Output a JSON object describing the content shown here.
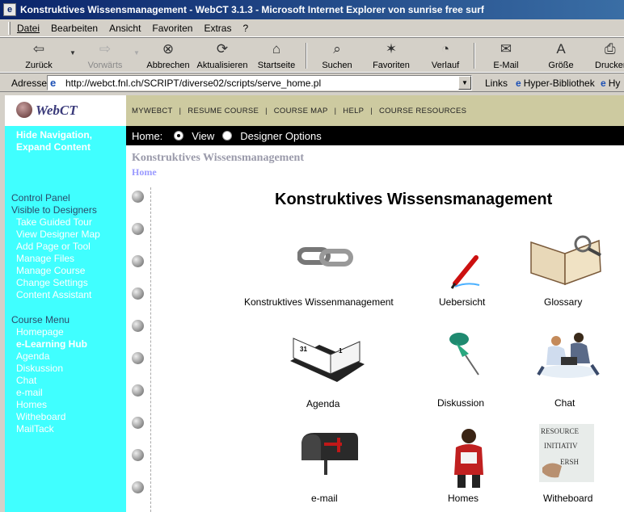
{
  "window": {
    "title": "Konstruktives Wissensmanagement - WebCT 3.1.3 - Microsoft Internet Explorer von sunrise free surf"
  },
  "menubar": [
    "Datei",
    "Bearbeiten",
    "Ansicht",
    "Favoriten",
    "Extras",
    "?"
  ],
  "toolbar": {
    "back": "Zurück",
    "forward": "Vorwärts",
    "stop": "Abbrechen",
    "refresh": "Aktualisieren",
    "home": "Startseite",
    "search": "Suchen",
    "favorites": "Favoriten",
    "history": "Verlauf",
    "mail": "E-Mail",
    "size": "Größe",
    "print": "Drucken"
  },
  "addressbar": {
    "label": "Adresse",
    "url": "http://webct.fnl.ch/SCRIPT/diverse02/scripts/serve_home.pl",
    "links_label": "Links",
    "links": [
      "Hyper-Bibliothek",
      "Hy"
    ]
  },
  "webct": {
    "logo": "WebCT",
    "topnav": [
      "MYWEBCT",
      "RESUME COURSE",
      "COURSE MAP",
      "HELP",
      "COURSE RESOURCES"
    ],
    "hide_nav": [
      "Hide Navigation,",
      "Expand Content"
    ],
    "homebar": {
      "label": "Home:",
      "options": [
        "View",
        "Designer Options"
      ],
      "selected": "View"
    },
    "breadcrumb": {
      "course": "Konstruktives Wissensmanagement",
      "page": "Home"
    },
    "control_panel": {
      "title": [
        "Control Panel",
        "Visible to Designers"
      ],
      "items": [
        "Take Guided Tour",
        "View Designer Map",
        "Add Page or Tool",
        "Manage Files",
        "Manage Course",
        "Change Settings",
        "Content Assistant"
      ]
    },
    "course_menu": {
      "title": "Course Menu",
      "items": [
        "Homepage",
        "e-Learning Hub",
        "Agenda",
        "Diskussion",
        "Chat",
        "e-mail",
        "Homes",
        "Witheboard",
        "MailTack"
      ],
      "current": "e-Learning Hub"
    },
    "main_title": "Konstruktives Wissensmanagement",
    "tiles": [
      {
        "label": "Konstruktives Wissenmanagement",
        "icon": "chain-link-icon"
      },
      {
        "label": "Uebersicht",
        "icon": "pen-icon"
      },
      {
        "label": "Glossary",
        "icon": "open-book-magnifier-icon"
      },
      {
        "label": "Agenda",
        "icon": "desk-calendar-icon"
      },
      {
        "label": "Diskussion",
        "icon": "pushpin-icon"
      },
      {
        "label": "Chat",
        "icon": "people-laptop-icon"
      },
      {
        "label": "e-mail",
        "icon": "mailbox-icon"
      },
      {
        "label": "Homes",
        "icon": "person-icon"
      },
      {
        "label": "Witheboard",
        "icon": "whiteboard-icon"
      }
    ]
  }
}
